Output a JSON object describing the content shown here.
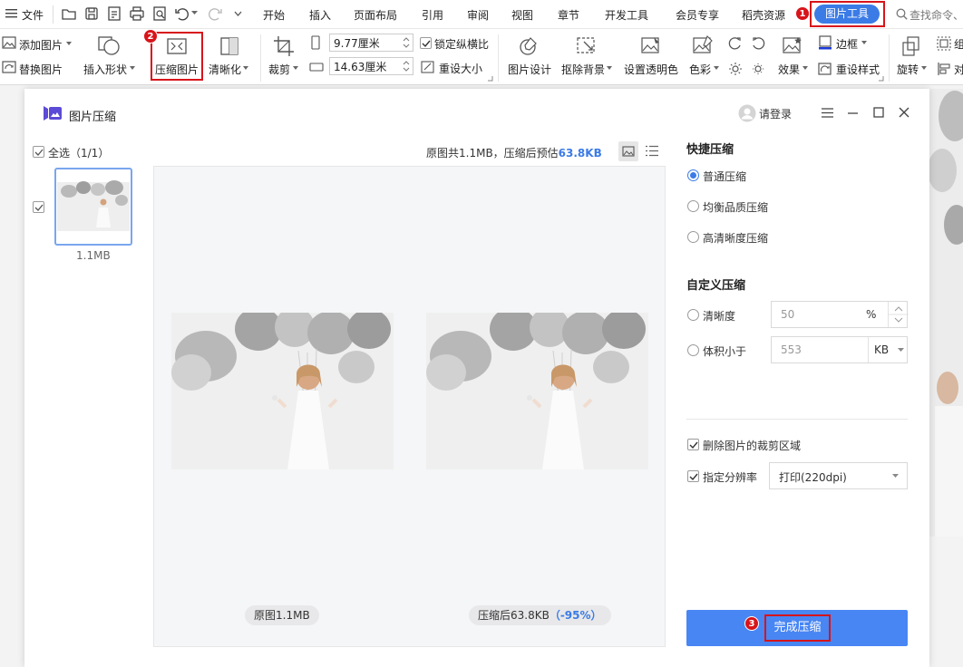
{
  "menubar": {
    "file_label": "文件",
    "tabs": [
      "开始",
      "插入",
      "页面布局",
      "引用",
      "审阅",
      "视图",
      "章节",
      "开发工具",
      "会员专享",
      "稻壳资源"
    ],
    "active_tab": "图片工具",
    "search_placeholder": "查找命令、"
  },
  "ribbon": {
    "add_picture": "添加图片",
    "replace_picture": "替换图片",
    "insert_shape": "插入形状",
    "compress_picture": "压缩图片",
    "sharpen": "清晰化",
    "crop": "裁剪",
    "width_value": "9.77厘米",
    "height_value": "14.63厘米",
    "lock_ratio": "锁定纵横比",
    "reset_size": "重设大小",
    "picture_design": "图片设计",
    "remove_background": "抠除背景",
    "set_transparent": "设置透明色",
    "color": "色彩",
    "effects": "效果",
    "border": "边框",
    "reset_style": "重设样式",
    "rotate": "旋转",
    "group_partial": "组",
    "align_partial": "对"
  },
  "badges": {
    "step1": "1",
    "step2": "2",
    "step3": "3"
  },
  "dialog": {
    "title": "图片压缩",
    "login": "请登录",
    "select_all": "全选（1/1）",
    "thumb_size": "1.1MB",
    "summary_prefix": "原图共1.1MB，压缩后预估",
    "summary_value": "63.8KB",
    "original_label": "原图1.1MB",
    "compressed_label": "压缩后63.8KB",
    "compressed_pct": "（-95%）",
    "quick_title": "快捷压缩",
    "quick_options": [
      "普通压缩",
      "均衡品质压缩",
      "高清晰度压缩"
    ],
    "custom_title": "自定义压缩",
    "clarity_label": "清晰度",
    "clarity_value": "50",
    "clarity_unit": "%",
    "size_label": "体积小于",
    "size_value": "553",
    "size_unit": "KB",
    "delete_crop": "删除图片的裁剪区域",
    "resolution_label": "指定分辨率",
    "resolution_value": "打印(220dpi)",
    "finish_button": "完成压缩"
  },
  "colors": {
    "accent": "#3b7be6",
    "button": "#4886f4",
    "red": "#d7141a",
    "summary_value": "#3b7be6"
  }
}
